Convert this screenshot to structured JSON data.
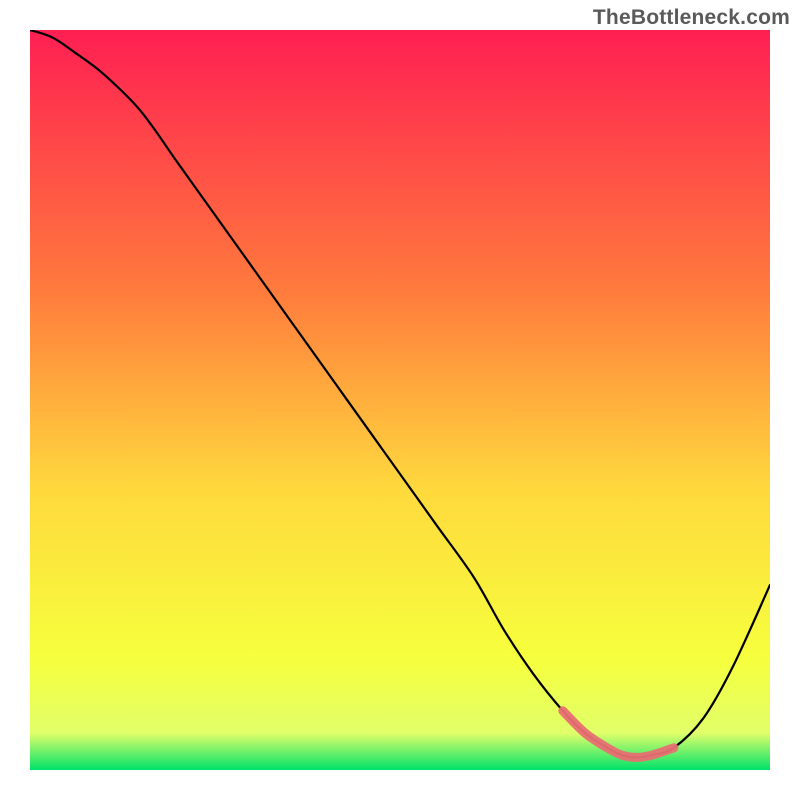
{
  "watermark": "TheBottleneck.com",
  "colors": {
    "gradient_top": "#ff1f52",
    "gradient_mid_upper": "#ff7a3d",
    "gradient_mid": "#ffd93d",
    "gradient_mid_lower": "#f6ff3d",
    "gradient_near_bottom": "#e1ff6a",
    "gradient_bottom": "#00e26a",
    "curve": "#000000",
    "highlight": "#e86f72"
  },
  "chart_data": {
    "type": "line",
    "title": "",
    "xlabel": "",
    "ylabel": "",
    "xlim": [
      0,
      100
    ],
    "ylim": [
      0,
      100
    ],
    "series": [
      {
        "name": "curve",
        "x": [
          0,
          3,
          6,
          10,
          15,
          20,
          25,
          30,
          35,
          40,
          45,
          50,
          55,
          60,
          64,
          68,
          72,
          75,
          78,
          80,
          82,
          84,
          87,
          91,
          95,
          100
        ],
        "y": [
          100,
          99,
          97,
          94,
          89,
          82,
          75,
          68,
          61,
          54,
          47,
          40,
          33,
          26,
          19,
          13,
          8,
          5,
          3,
          2,
          1.7,
          2,
          3,
          7,
          14,
          25
        ]
      }
    ],
    "highlight_range": {
      "x_start": 72,
      "x_end": 87
    },
    "annotations": []
  }
}
